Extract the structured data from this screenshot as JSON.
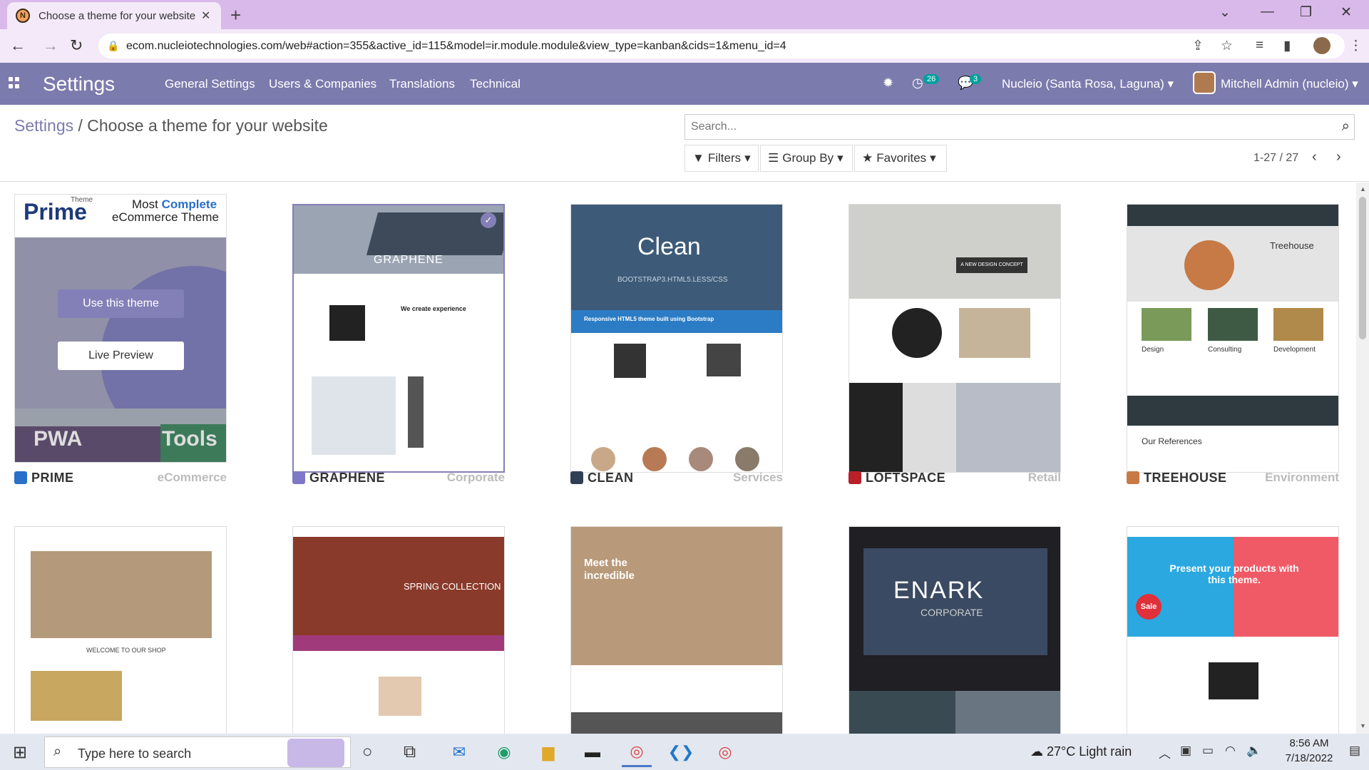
{
  "browser": {
    "tab_title": "Choose a theme for your website",
    "new_tab": "+",
    "url": "ecom.nucleiotechnologies.com/web#action=355&active_id=115&model=ir.module.module&view_type=kanban&cids=1&menu_id=4"
  },
  "navbar": {
    "app_title": "Settings",
    "menu": [
      "General Settings",
      "Users & Companies",
      "Translations",
      "Technical"
    ],
    "activity_count": "26",
    "message_count": "3",
    "company": "Nucleio (Santa Rosa, Laguna)",
    "user": "Mitchell Admin (nucleio)"
  },
  "control": {
    "breadcrumb_root": "Settings",
    "breadcrumb_sep": "/",
    "breadcrumb_current": "Choose a theme for your website",
    "search_placeholder": "Search...",
    "filters_label": "Filters",
    "groupby_label": "Group By",
    "favorites_label": "Favorites",
    "pager": "1-27 / 27"
  },
  "themes": [
    {
      "name": "PRIME",
      "category": "eCommerce",
      "icon_color": "#2a6fc9"
    },
    {
      "name": "GRAPHENE",
      "category": "Corporate",
      "icon_color": "#7f78c8"
    },
    {
      "name": "CLEAN",
      "category": "Services",
      "icon_color": "#2e3f55"
    },
    {
      "name": "LOFTSPACE",
      "category": "Retail",
      "icon_color": "#b8202a"
    },
    {
      "name": "TREEHOUSE",
      "category": "Environment",
      "icon_color": "#c77a45"
    }
  ],
  "prime": {
    "top_word": "Prime",
    "theme_word": "Theme",
    "tagline_1": "Most",
    "tagline_highlight": "Complete",
    "tagline_2": "eCommerce Theme",
    "use_button": "Use this theme",
    "preview_button": "Live Preview",
    "pwa": "PWA",
    "tools": "Tools"
  },
  "graphene": {
    "logo": "GRAPHENE",
    "heading": "We create experience"
  },
  "clean": {
    "logo": "Clean",
    "sub": "BOOTSTRAP3.HTML5.LESS/CSS",
    "banner": "Responsive HTML5 theme built using Bootstrap"
  },
  "loftspace": {
    "concept": "A NEW DESIGN CONCEPT"
  },
  "treehouse": {
    "title": "Treehouse",
    "col1": "Design",
    "col2": "Consulting",
    "col3": "Development",
    "refs": "Our References"
  },
  "row2": {
    "welcome": "WELCOME TO OUR SHOP",
    "spring": "SPRING COLLECTION",
    "meet": "Meet the incredible",
    "enark": "ENARK",
    "enark_sub": "CORPORATE",
    "present": "Present your products with this theme.",
    "sale": "Sale"
  },
  "taskbar": {
    "search_placeholder": "Type here to search",
    "weather": "27°C  Light rain",
    "time": "8:56 AM",
    "date": "7/18/2022"
  }
}
